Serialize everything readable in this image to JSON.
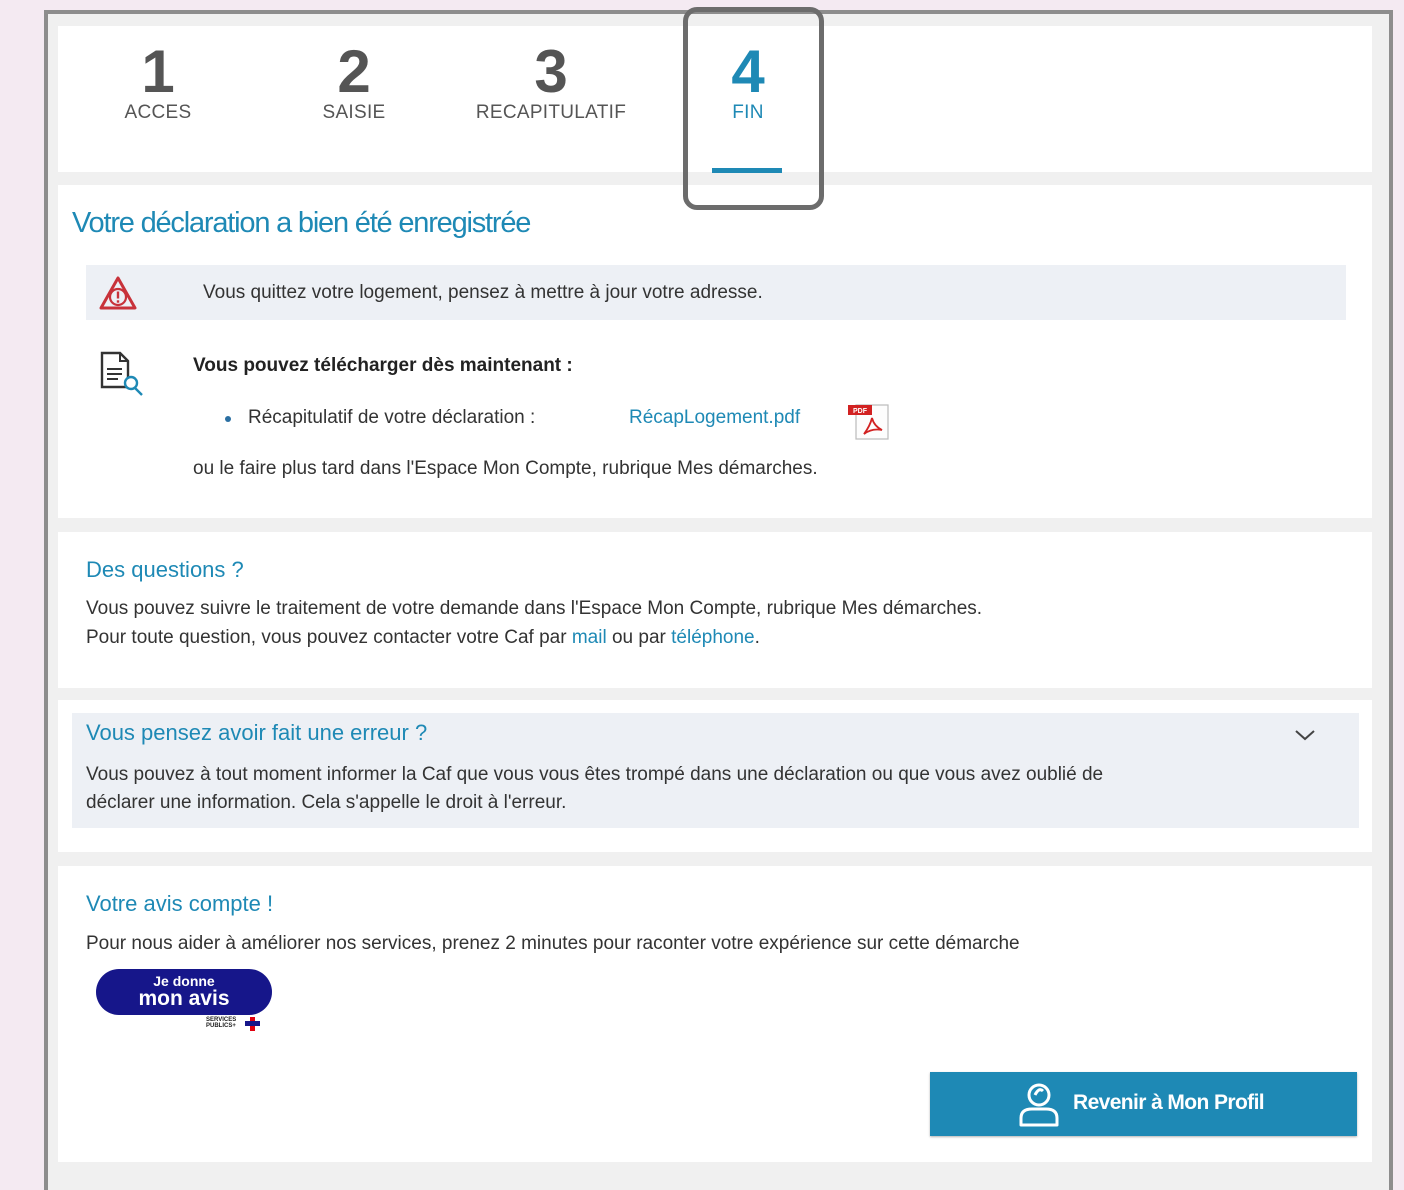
{
  "stepper": {
    "steps": [
      {
        "number": "1",
        "label": "ACCES",
        "active": false
      },
      {
        "number": "2",
        "label": "SAISIE",
        "active": false
      },
      {
        "number": "3",
        "label": "RECAPITULATIF",
        "active": false
      },
      {
        "number": "4",
        "label": "FIN",
        "active": true
      }
    ]
  },
  "confirmation": {
    "title": "Votre déclaration a bien été enregistrée",
    "alert_icon": "warning-triangle-icon",
    "alert_text": "Vous quittez votre logement, pensez à mettre à jour votre adresse.",
    "doc_icon": "document-search-icon",
    "download_title": "Vous pouvez télécharger dès maintenant :",
    "recap_label": "Récapitulatif de votre déclaration :",
    "pdf_link": "RécapLogement.pdf",
    "pdf_icon": "pdf-file-icon",
    "pdf_icon_text": "PDF",
    "later_text": "ou le faire plus tard dans l'Espace Mon Compte, rubrique Mes démarches."
  },
  "questions": {
    "title": "Des questions ?",
    "line1": "Vous pouvez suivre le traitement de votre demande dans l'Espace Mon Compte, rubrique Mes démarches.",
    "line2_prefix": "Pour toute question, vous pouvez contacter votre Caf par ",
    "mail_link": "mail",
    "line2_middle": " ou par ",
    "phone_link": "téléphone",
    "line2_suffix": "."
  },
  "error": {
    "title": "Vous pensez avoir fait une erreur ?",
    "line1": "Vous pouvez à tout moment informer la Caf que vous vous êtes trompé dans une déclaration ou que vous avez oublié de",
    "line2": "déclarer une information. Cela s'appelle le droit à l'erreur.",
    "chevron_icon": "chevron-down-icon"
  },
  "feedback": {
    "title": "Votre avis compte !",
    "text": "Pour nous aider à améliorer nos services, prenez 2 minutes pour raconter votre expérience sur cette démarche",
    "badge_small": "Je donne",
    "badge_big": "mon avis",
    "logo_line1": "SERVICES",
    "logo_line2": "PUBLICS+"
  },
  "return_button": {
    "label": "Revenir à Mon Profil",
    "icon": "user-icon"
  },
  "colors": {
    "accent": "#1e89b5",
    "alert_bg": "#edf0f5",
    "warning": "#c8323a",
    "badge": "#16168a"
  }
}
